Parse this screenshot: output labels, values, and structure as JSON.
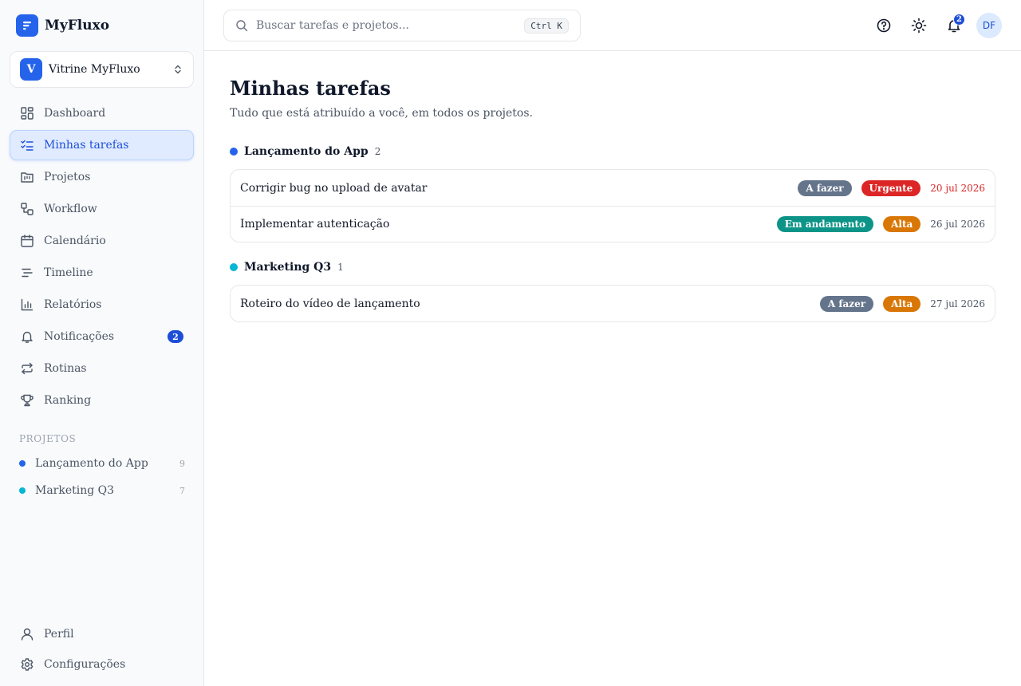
{
  "app": {
    "name": "MyFluxo"
  },
  "workspace": {
    "initial": "V",
    "name": "Vitrine MyFluxo"
  },
  "sidebar": {
    "items": [
      {
        "label": "Dashboard",
        "icon": "dashboard-icon"
      },
      {
        "label": "Minhas tarefas",
        "icon": "checklist-icon",
        "active": true
      },
      {
        "label": "Projetos",
        "icon": "folder-kanban-icon"
      },
      {
        "label": "Workflow",
        "icon": "workflow-icon"
      },
      {
        "label": "Calendário",
        "icon": "calendar-icon"
      },
      {
        "label": "Timeline",
        "icon": "timeline-icon"
      },
      {
        "label": "Relatórios",
        "icon": "bar-chart-icon"
      },
      {
        "label": "Notificações",
        "icon": "bell-icon",
        "badge": "2"
      },
      {
        "label": "Rotinas",
        "icon": "repeat-icon"
      },
      {
        "label": "Ranking",
        "icon": "trophy-icon"
      }
    ],
    "projects_title": "PROJETOS",
    "projects": [
      {
        "name": "Lançamento do App",
        "count": "9",
        "color": "#2563eb"
      },
      {
        "name": "Marketing Q3",
        "count": "7",
        "color": "#06b6d4"
      }
    ],
    "bottom": [
      {
        "label": "Perfil",
        "icon": "user-icon"
      },
      {
        "label": "Configurações",
        "icon": "gear-icon"
      }
    ]
  },
  "header": {
    "search_placeholder": "Buscar tarefas e projetos...",
    "search_shortcut": "Ctrl K",
    "notification_count": "2",
    "user_initials": "DF"
  },
  "main": {
    "title": "Minhas tarefas",
    "subtitle": "Tudo que está atribuído a você, em todos os projetos.",
    "groups": [
      {
        "name": "Lançamento do App",
        "count": "2",
        "color": "#2563eb",
        "tasks": [
          {
            "title": "Corrigir bug no upload de avatar",
            "status": "A fazer",
            "priority": "Urgente",
            "date": "20 jul 2026"
          },
          {
            "title": "Implementar autenticação",
            "status": "Em andamento",
            "priority": "Alta",
            "date": "26 jul 2026"
          }
        ]
      },
      {
        "name": "Marketing Q3",
        "count": "1",
        "color": "#06b6d4",
        "tasks": [
          {
            "title": "Roteiro do vídeo de lançamento",
            "status": "A fazer",
            "priority": "Alta",
            "date": "27 jul 2026"
          }
        ]
      }
    ]
  },
  "colors": {
    "accent": "#2563eb",
    "status_todo": "#64748b",
    "status_in_progress": "#0d9488",
    "priority_urgent": "#dc2626",
    "priority_high": "#d97706",
    "overdue_date": "#dc2626"
  }
}
